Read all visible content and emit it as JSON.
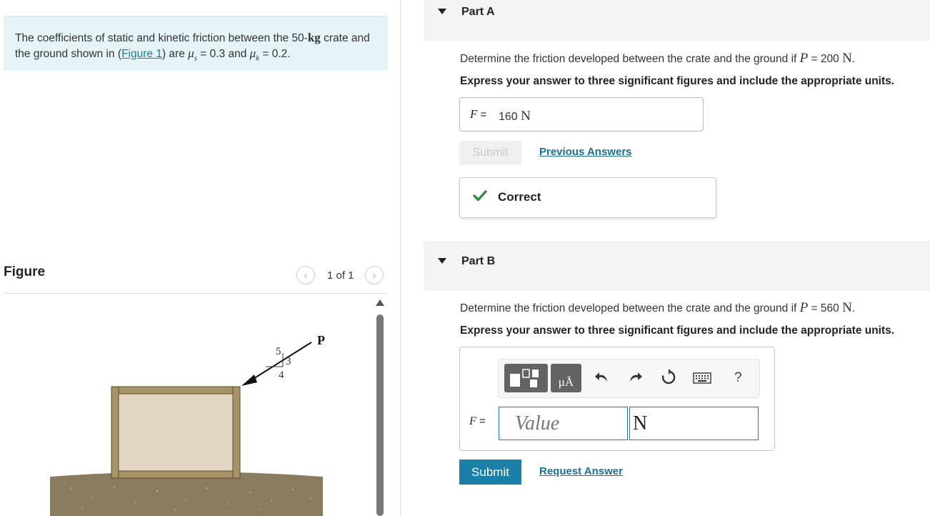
{
  "problem": {
    "text_before_mass": "The coefficients of static and kinetic friction between the 50-",
    "mass_unit": "kg",
    "text_after_mass": " crate and the ground shown in (",
    "figure_link": "Figure 1",
    "text_after_link": ") are ",
    "mu_s_symbol": "μs",
    "mu_s_value": " = 0.3 and ",
    "mu_k_symbol": "μk",
    "mu_k_value": " = 0.2."
  },
  "figure": {
    "title": "Figure",
    "counter": "1 of 1",
    "prev_icon": "‹",
    "next_icon": "›",
    "force_label": "P",
    "slope_hyp": "5",
    "slope_rise": "3",
    "slope_run": "4"
  },
  "partA": {
    "title": "Part A",
    "question_pre": "Determine the friction developed between the crate and the ground if ",
    "question_var": "P",
    "question_eq": " = 200 ",
    "question_unit": "N",
    "question_end": ".",
    "instruction": "Express your answer to three significant figures and include the appropriate units.",
    "answer_label_var": "F",
    "answer_label_eq": " =",
    "answer_value": "160 ",
    "answer_unit": "N",
    "submit_label": "Submit",
    "previous_answers_label": "Previous Answers",
    "feedback": "Correct"
  },
  "partB": {
    "title": "Part B",
    "question_pre": "Determine the friction developed between the crate and the ground if ",
    "question_var": "P",
    "question_eq": " = 560 ",
    "question_unit": "N",
    "question_end": ".",
    "instruction": "Express your answer to three significant figures and include the appropriate units.",
    "toolbar": {
      "units_label": "μÅ",
      "help_label": "?"
    },
    "answer_label_var": "F",
    "answer_label_eq": " =",
    "value_placeholder": "Value",
    "unit_value": "N",
    "submit_label": "Submit",
    "request_answer_label": "Request Answer"
  },
  "colors": {
    "accent": "#1a7fa7",
    "link": "#1b6f92",
    "correct_green": "#2e8b3a",
    "problem_bg": "#e6f4f7"
  }
}
